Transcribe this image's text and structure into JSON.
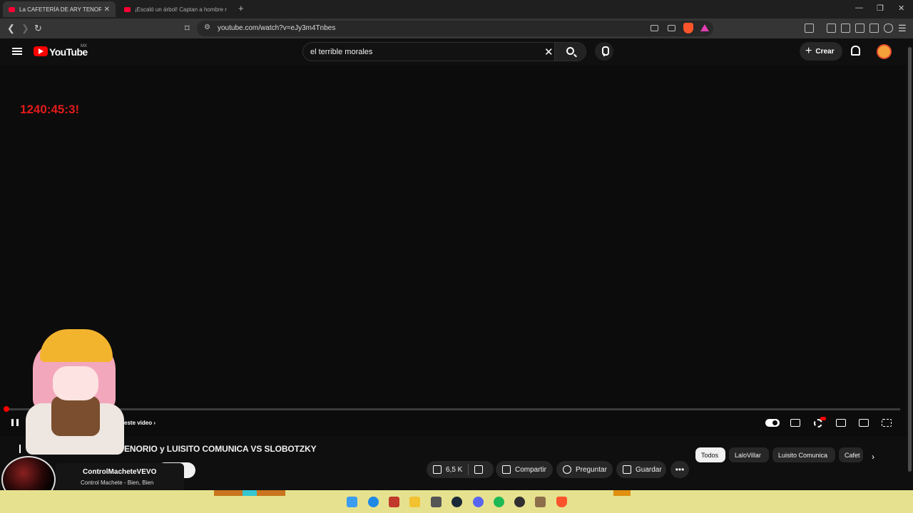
{
  "browser": {
    "tabs": [
      {
        "title": "La CAFETERÍA DE ARY TENORIO",
        "active": true
      },
      {
        "title": "¡Escaló un árbol! Captan a hombre ru",
        "active": false
      }
    ],
    "url": "youtube.com/watch?v=eJy3m4Tnbes"
  },
  "youtube": {
    "logo_text": "YouTube",
    "country_code": "MX",
    "search_value": "el terrible morales",
    "create_label": "Crear",
    "accent_color": "#ff0000"
  },
  "player": {
    "overlay_timer": "1240:45:3!",
    "progress_fraction": 0.001,
    "suggestion_text": "este video"
  },
  "video": {
    "title_fragment": "ENORIO y LUISITO COMUNICA VS SLOBOTZKY",
    "actions": {
      "likes": "6,5 K",
      "share": "Compartir",
      "ask": "Preguntar",
      "save": "Guardar"
    }
  },
  "chips": [
    "Todos",
    "LaloVillar",
    "Luisito Comunica",
    "Cafet"
  ],
  "now_playing": {
    "artist": "ControlMacheteVEVO",
    "song": "Control Machete - Bien, Bien"
  }
}
